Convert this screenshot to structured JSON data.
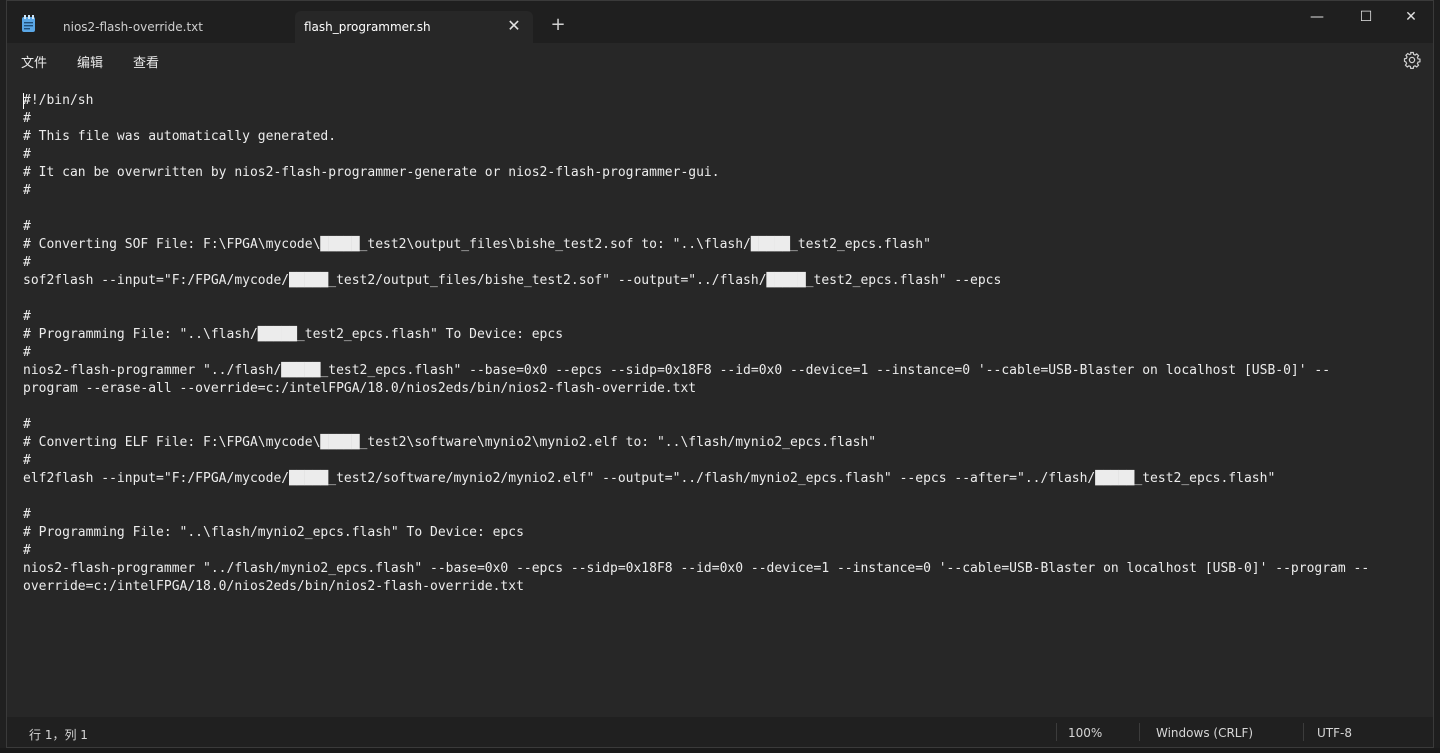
{
  "tabs": [
    {
      "label": "nios2-flash-override.txt"
    },
    {
      "label": "flash_programmer.sh",
      "close": "✕"
    }
  ],
  "new_tab": "+",
  "window_controls": {
    "minimize": "—",
    "maximize": "☐",
    "close": "✕"
  },
  "menu": {
    "file": "文件",
    "edit": "编辑",
    "view": "查看"
  },
  "icons": {
    "app": "notepad-icon",
    "settings": "gear-icon"
  },
  "editor": {
    "lines": [
      "#!/bin/sh",
      "#",
      "# This file was automatically generated.",
      "#",
      "# It can be overwritten by nios2-flash-programmer-generate or nios2-flash-programmer-gui.",
      "#",
      "",
      "#",
      "# Converting SOF File: F:\\FPGA\\mycode\\█████_test2\\output_files\\bishe_test2.sof to: \"..\\flash/█████_test2_epcs.flash\"",
      "#",
      "sof2flash --input=\"F:/FPGA/mycode/█████_test2/output_files/bishe_test2.sof\" --output=\"../flash/█████_test2_epcs.flash\" --epcs",
      "",
      "#",
      "# Programming File: \"..\\flash/█████_test2_epcs.flash\" To Device: epcs",
      "#",
      "nios2-flash-programmer \"../flash/█████_test2_epcs.flash\" --base=0x0 --epcs --sidp=0x18F8 --id=0x0 --device=1 --instance=0 '--cable=USB-Blaster on localhost [USB-0]' --",
      "program --erase-all --override=c:/intelFPGA/18.0/nios2eds/bin/nios2-flash-override.txt",
      "",
      "#",
      "# Converting ELF File: F:\\FPGA\\mycode\\█████_test2\\software\\mynio2\\mynio2.elf to: \"..\\flash/mynio2_epcs.flash\"",
      "#",
      "elf2flash --input=\"F:/FPGA/mycode/█████_test2/software/mynio2/mynio2.elf\" --output=\"../flash/mynio2_epcs.flash\" --epcs --after=\"../flash/█████_test2_epcs.flash\"",
      "",
      "#",
      "# Programming File: \"..\\flash/mynio2_epcs.flash\" To Device: epcs",
      "#",
      "nios2-flash-programmer \"../flash/mynio2_epcs.flash\" --base=0x0 --epcs --sidp=0x18F8 --id=0x0 --device=1 --instance=0 '--cable=USB-Blaster on localhost [USB-0]' --program --",
      "override=c:/intelFPGA/18.0/nios2eds/bin/nios2-flash-override.txt"
    ]
  },
  "status": {
    "position": "行 1，列 1",
    "zoom": "100%",
    "line_ending": "Windows (CRLF)",
    "encoding": "UTF-8"
  }
}
